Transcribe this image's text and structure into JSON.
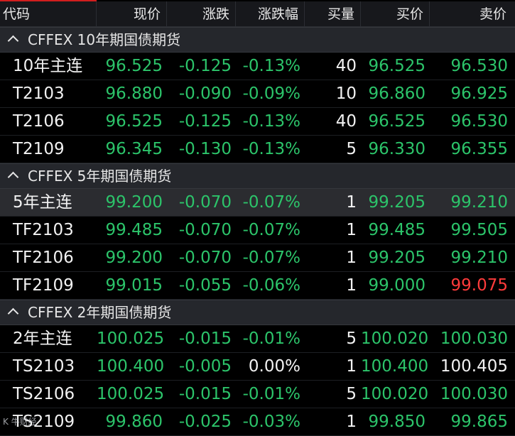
{
  "colors": {
    "green": "#2cc46a",
    "red": "#ff3b3b",
    "white": "#f2f2f2",
    "accent": "#d21e1e"
  },
  "header": {
    "columns": [
      "代码",
      "现价",
      "涨跌",
      "涨跌幅",
      "买量",
      "买价",
      "卖价"
    ]
  },
  "groups": [
    {
      "label": "CFFEX 10年期国债期货",
      "rows": [
        {
          "code": "10年主连",
          "price": "96.525",
          "change": "-0.125",
          "pct": "-0.13%",
          "bid_vol": "40",
          "bid": "96.525",
          "ask": "96.530",
          "pct_color": "green",
          "ask_color": "green"
        },
        {
          "code": "T2103",
          "price": "96.880",
          "change": "-0.090",
          "pct": "-0.09%",
          "bid_vol": "10",
          "bid": "96.860",
          "ask": "96.925",
          "pct_color": "green",
          "ask_color": "green"
        },
        {
          "code": "T2106",
          "price": "96.525",
          "change": "-0.125",
          "pct": "-0.13%",
          "bid_vol": "40",
          "bid": "96.525",
          "ask": "96.530",
          "pct_color": "green",
          "ask_color": "green"
        },
        {
          "code": "T2109",
          "price": "96.345",
          "change": "-0.130",
          "pct": "-0.13%",
          "bid_vol": "5",
          "bid": "96.330",
          "ask": "96.355",
          "pct_color": "green",
          "ask_color": "green"
        }
      ]
    },
    {
      "label": "CFFEX 5年期国债期货",
      "rows": [
        {
          "code": "5年主连",
          "price": "99.200",
          "change": "-0.070",
          "pct": "-0.07%",
          "bid_vol": "1",
          "bid": "99.205",
          "ask": "99.210",
          "pct_color": "green",
          "ask_color": "green",
          "selected": true
        },
        {
          "code": "TF2103",
          "price": "99.485",
          "change": "-0.070",
          "pct": "-0.07%",
          "bid_vol": "1",
          "bid": "99.485",
          "ask": "99.505",
          "pct_color": "green",
          "ask_color": "green"
        },
        {
          "code": "TF2106",
          "price": "99.200",
          "change": "-0.070",
          "pct": "-0.07%",
          "bid_vol": "1",
          "bid": "99.205",
          "ask": "99.210",
          "pct_color": "green",
          "ask_color": "green"
        },
        {
          "code": "TF2109",
          "price": "99.015",
          "change": "-0.055",
          "pct": "-0.06%",
          "bid_vol": "1",
          "bid": "99.000",
          "ask": "99.075",
          "pct_color": "green",
          "ask_color": "red"
        }
      ]
    },
    {
      "label": "CFFEX 2年期国债期货",
      "rows": [
        {
          "code": "2年主连",
          "price": "100.025",
          "change": "-0.015",
          "pct": "-0.01%",
          "bid_vol": "5",
          "bid": "100.020",
          "ask": "100.030",
          "pct_color": "green",
          "ask_color": "green"
        },
        {
          "code": "TS2103",
          "price": "100.400",
          "change": "-0.005",
          "pct": "0.00%",
          "bid_vol": "1",
          "bid": "100.400",
          "ask": "100.405",
          "pct_color": "white",
          "ask_color": "white"
        },
        {
          "code": "TS2106",
          "price": "100.025",
          "change": "-0.015",
          "pct": "-0.01%",
          "bid_vol": "5",
          "bid": "100.020",
          "ask": "100.030",
          "pct_color": "green",
          "ask_color": "green"
        },
        {
          "code": "TS2109",
          "price": "99.860",
          "change": "-0.025",
          "pct": "-0.03%",
          "bid_vol": "1",
          "bid": "99.850",
          "ask": "99.865",
          "pct_color": "green",
          "ask_color": "green"
        }
      ]
    }
  ],
  "watermark": "K 牛财经"
}
